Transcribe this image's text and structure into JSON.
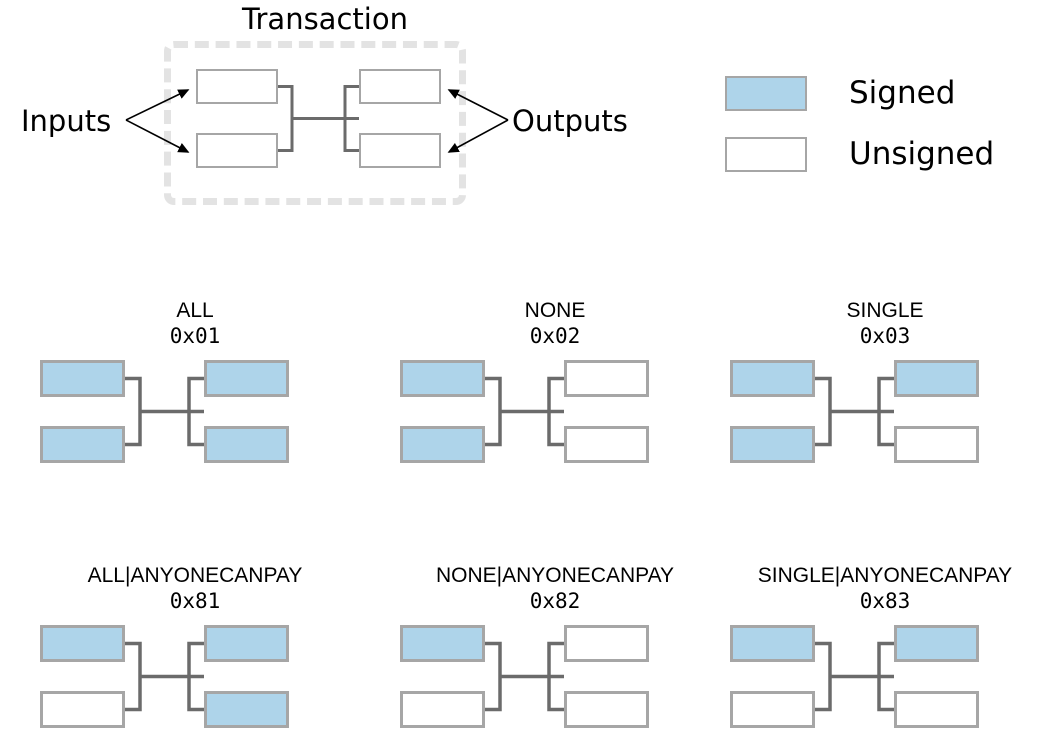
{
  "transaction": {
    "title": "Transaction",
    "inputs_label": "Inputs",
    "outputs_label": "Outputs",
    "inputs": [
      {
        "name": "input-0",
        "state": "unsigned"
      },
      {
        "name": "input-1",
        "state": "unsigned"
      }
    ],
    "outputs": [
      {
        "name": "output-0",
        "state": "unsigned"
      },
      {
        "name": "output-1",
        "state": "unsigned"
      }
    ]
  },
  "legend": {
    "signed_label": "Signed",
    "unsigned_label": "Unsigned",
    "signed_color": "#aed4ea",
    "unsigned_color": "#ffffff",
    "border_color": "#a6a6a6"
  },
  "colors": {
    "signed_fill": "#aed4ea",
    "unsigned_fill": "#ffffff",
    "box_border": "#a6a6a6",
    "connector": "#6b6b6b",
    "dashed_border": "#e3e3e3",
    "text": "#000000"
  },
  "panels": [
    {
      "id": "all",
      "title": "ALL",
      "code": "0x01",
      "inputs": [
        "signed",
        "signed"
      ],
      "outputs": [
        "signed",
        "signed"
      ]
    },
    {
      "id": "none",
      "title": "NONE",
      "code": "0x02",
      "inputs": [
        "signed",
        "signed"
      ],
      "outputs": [
        "unsigned",
        "unsigned"
      ]
    },
    {
      "id": "single",
      "title": "SINGLE",
      "code": "0x03",
      "inputs": [
        "signed",
        "signed"
      ],
      "outputs": [
        "signed",
        "unsigned"
      ]
    },
    {
      "id": "all-anyonecanpay",
      "title": "ALL|ANYONECANPAY",
      "code": "0x81",
      "inputs": [
        "signed",
        "unsigned"
      ],
      "outputs": [
        "signed",
        "signed"
      ]
    },
    {
      "id": "none-anyonecanpay",
      "title": "NONE|ANYONECANPAY",
      "code": "0x82",
      "inputs": [
        "signed",
        "unsigned"
      ],
      "outputs": [
        "unsigned",
        "unsigned"
      ]
    },
    {
      "id": "single-anyonecanpay",
      "title": "SINGLE|ANYONECANPAY",
      "code": "0x83",
      "inputs": [
        "signed",
        "unsigned"
      ],
      "outputs": [
        "signed",
        "unsigned"
      ]
    }
  ]
}
